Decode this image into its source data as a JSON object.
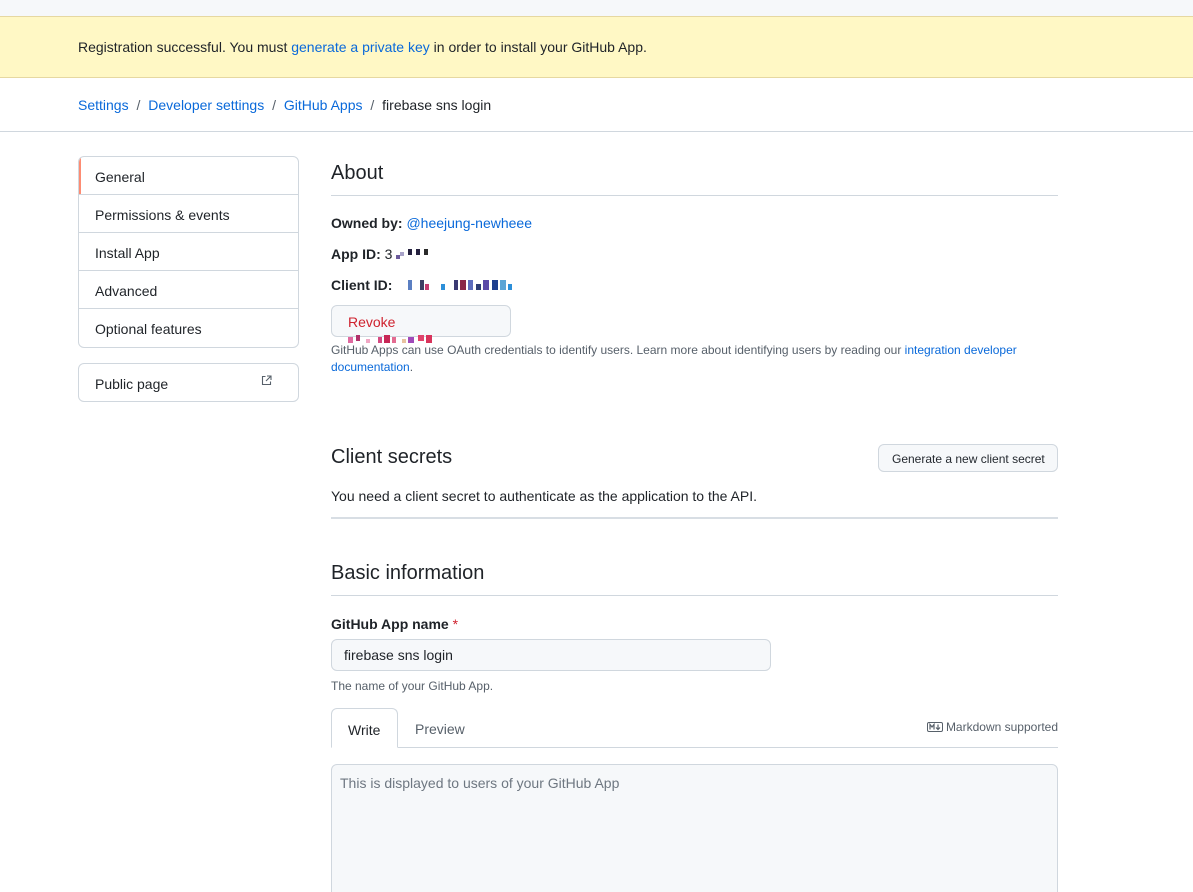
{
  "flash": {
    "prefix": "Registration successful. You must ",
    "link": "generate a private key",
    "suffix": " in order to install your GitHub App."
  },
  "breadcrumb": {
    "items": [
      "Settings",
      "Developer settings",
      "GitHub Apps"
    ],
    "current": "firebase sns login",
    "separator": "/"
  },
  "sidebar": {
    "items": [
      {
        "label": "General"
      },
      {
        "label": "Permissions & events"
      },
      {
        "label": "Install App"
      },
      {
        "label": "Advanced"
      },
      {
        "label": "Optional features"
      }
    ],
    "public_page": "Public page"
  },
  "about": {
    "title": "About",
    "owned_by_label": "Owned by:",
    "owner": "@heejung-newheee",
    "app_id_label": "App ID:",
    "app_id_visible": "3",
    "client_id_label": "Client ID:",
    "revoke_label": "Revoke",
    "help_text": "GitHub Apps can use OAuth credentials to identify users. Learn more about identifying users by reading our ",
    "help_link": "integration developer documentation",
    "help_end": "."
  },
  "client_secrets": {
    "title": "Client secrets",
    "generate_label": "Generate a new client secret",
    "description": "You need a client secret to authenticate as the application to the API."
  },
  "basic": {
    "title": "Basic information",
    "name_label": "GitHub App name",
    "required_mark": "*",
    "name_value": "firebase sns login",
    "name_note": "The name of your GitHub App.",
    "tabs": [
      "Write",
      "Preview"
    ],
    "markdown_label": "Markdown supported",
    "description_placeholder": "This is displayed to users of your GitHub App"
  },
  "colors": {
    "link": "#0969da",
    "danger": "#cf222e",
    "flash_bg": "#fff8c5",
    "active_nav": "#fd8c73"
  }
}
